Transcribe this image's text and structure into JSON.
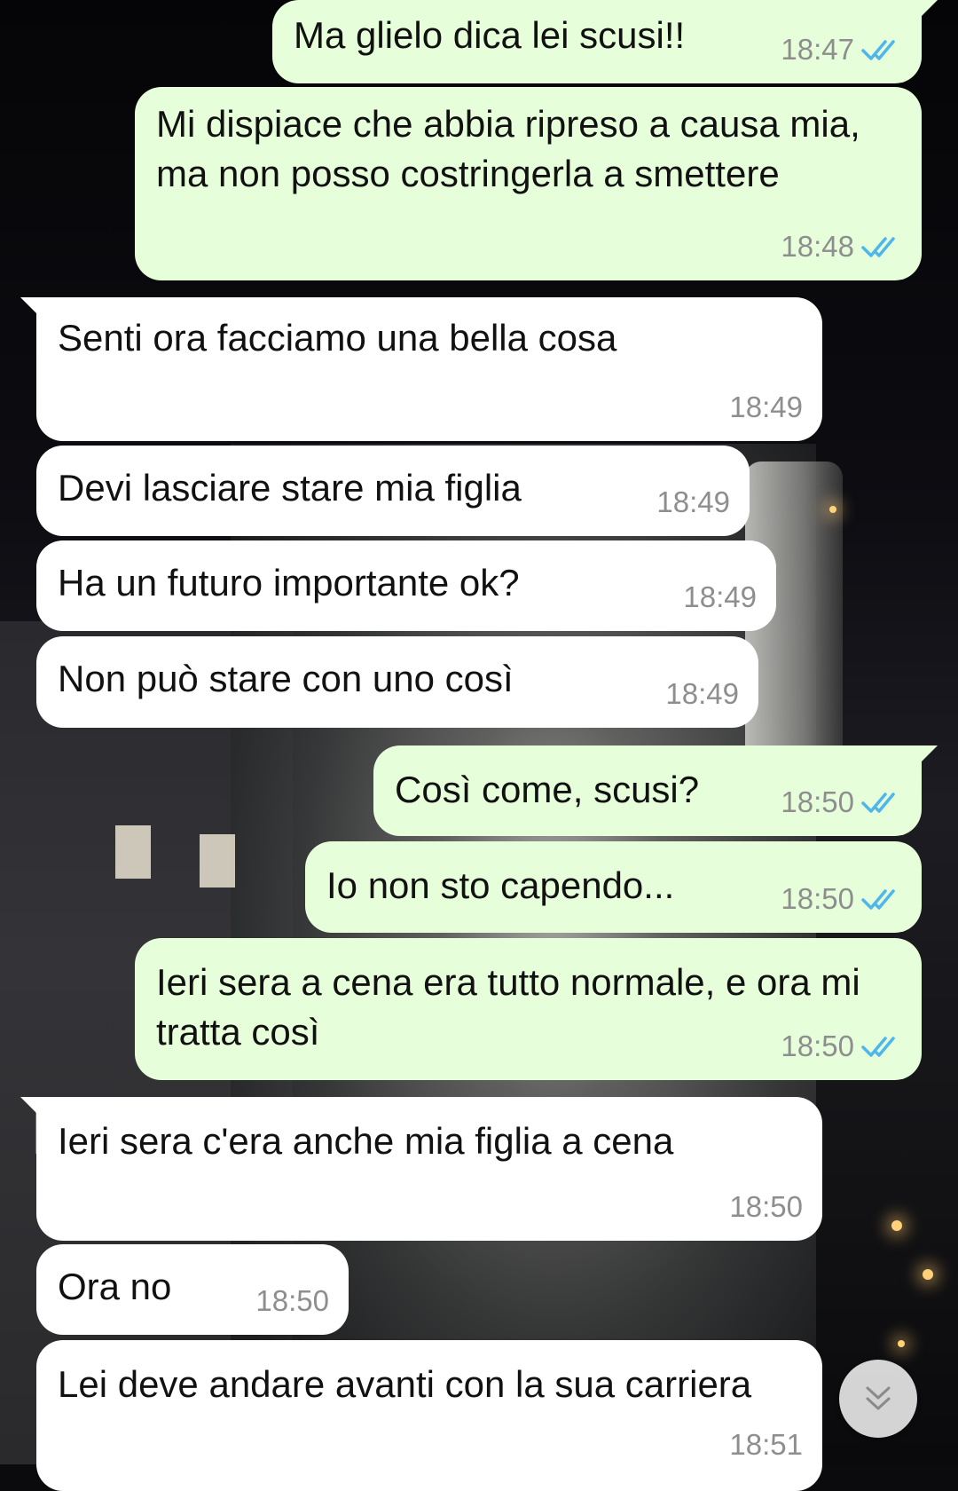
{
  "messages": [
    {
      "dir": "out",
      "text": "Ma glielo dica lei scusi!!",
      "time": "18:47",
      "status": "read"
    },
    {
      "dir": "out",
      "text": "Mi dispiace che abbia ripreso a causa mia, ma non posso costringerla a smettere",
      "time": "18:48",
      "status": "read"
    },
    {
      "dir": "in",
      "text": "Senti ora facciamo una bella cosa",
      "time": "18:49"
    },
    {
      "dir": "in",
      "text": "Devi lasciare stare mia figlia",
      "time": "18:49"
    },
    {
      "dir": "in",
      "text": "Ha un futuro importante ok?",
      "time": "18:49"
    },
    {
      "dir": "in",
      "text": "Non può stare con uno così",
      "time": "18:49"
    },
    {
      "dir": "out",
      "text": "Così come, scusi?",
      "time": "18:50",
      "status": "read"
    },
    {
      "dir": "out",
      "text": "Io non sto capendo...",
      "time": "18:50",
      "status": "read"
    },
    {
      "dir": "out",
      "text": "Ieri sera a cena era tutto normale, e ora mi tratta così",
      "time": "18:50",
      "status": "read"
    },
    {
      "dir": "in",
      "text": "Ieri sera c'era anche mia figlia a cena",
      "time": "18:50"
    },
    {
      "dir": "in",
      "text": "Ora no",
      "time": "18:50"
    },
    {
      "dir": "in",
      "text": "Lei deve andare avanti con la sua carriera",
      "time": "18:51"
    }
  ],
  "colors": {
    "outgoing_bubble": "#e6ffda",
    "incoming_bubble": "#ffffff",
    "read_ticks": "#4fb6ec",
    "timestamp": "#8e8e8e"
  },
  "icons": {
    "read_receipt": "double-check-icon",
    "scroll_down": "double-chevron-down-icon"
  }
}
